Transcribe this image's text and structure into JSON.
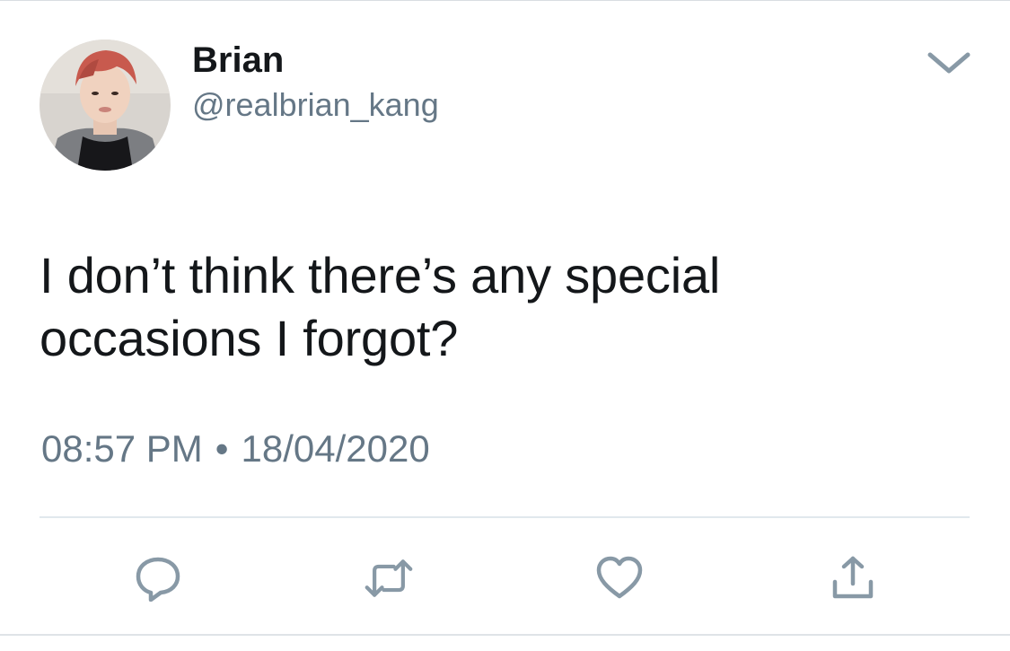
{
  "tweet": {
    "display_name": "Brian",
    "handle": "@realbrian_kang",
    "text_line1": "I don’t think there’s any special",
    "text_line2": "occasions I forgot?",
    "time": "08:57 PM",
    "separator": "•",
    "date": "18/04/2020"
  },
  "icons": {
    "menu": "chevron-down-icon",
    "reply": "reply-icon",
    "retweet": "retweet-icon",
    "like": "heart-icon",
    "share": "share-icon"
  },
  "colors": {
    "text": "#14171a",
    "secondary": "#657786",
    "icon": "#8899a6",
    "divider": "#e1e8ed"
  }
}
